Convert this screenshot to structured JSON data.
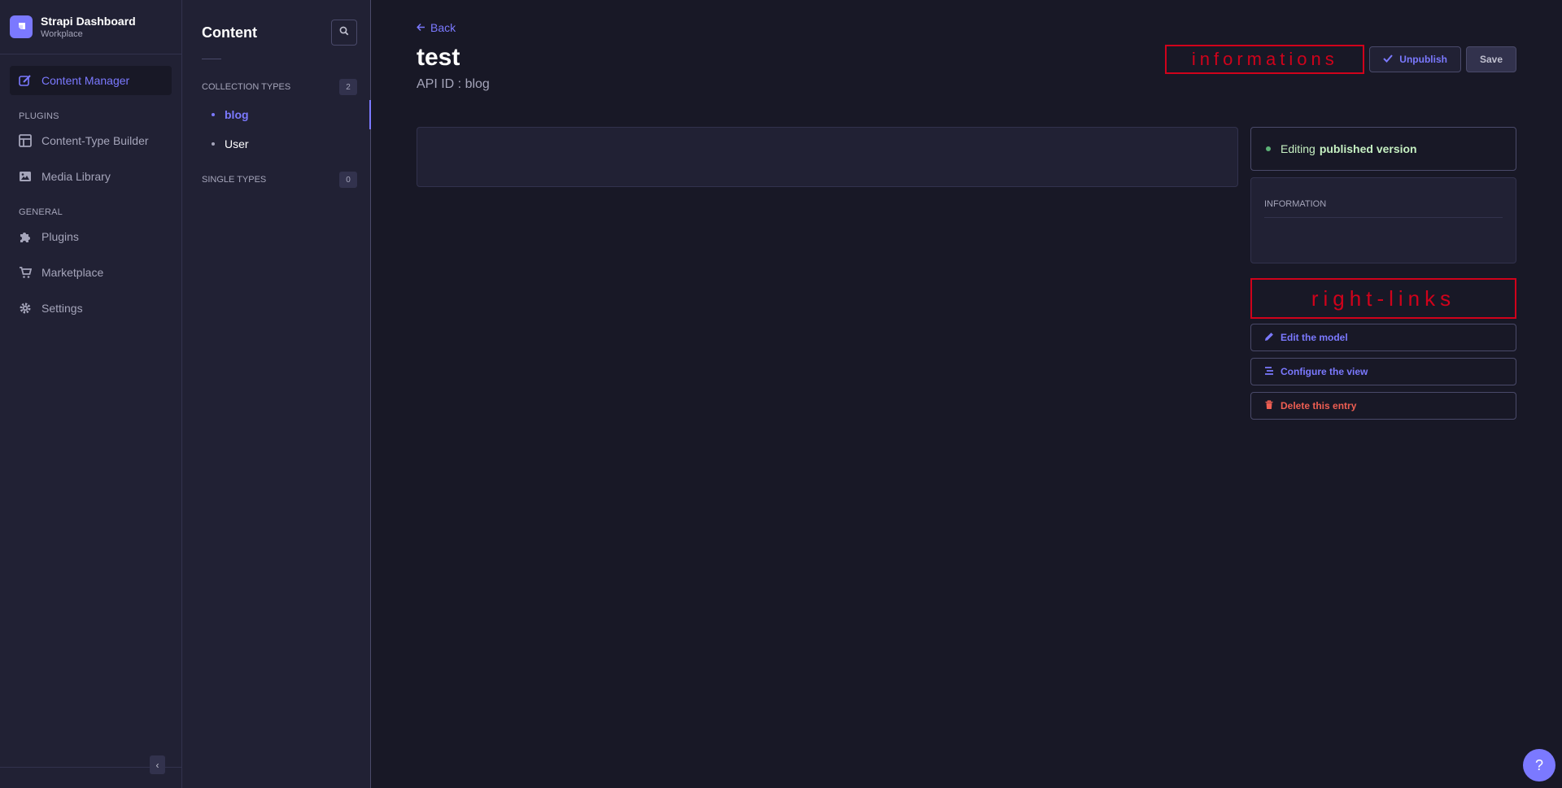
{
  "brand": {
    "name": "Strapi Dashboard",
    "workspace": "Workplace"
  },
  "mainnav": {
    "active_item": "Content Manager",
    "plugins_label": "PLUGINS",
    "plugins": [
      "Content-Type Builder",
      "Media Library"
    ],
    "general_label": "GENERAL",
    "general": [
      "Plugins",
      "Marketplace",
      "Settings"
    ]
  },
  "subnav": {
    "title": "Content",
    "collection_label": "COLLECTION TYPES",
    "collection_count": "2",
    "collection_items": [
      "blog",
      "User"
    ],
    "single_label": "SINGLE TYPES",
    "single_count": "0"
  },
  "header": {
    "back": "Back",
    "title": "test",
    "subtitle": "API ID : blog",
    "annotation": "informations",
    "unpublish": "Unpublish",
    "save": "Save"
  },
  "sidebar": {
    "status_prefix": "Editing",
    "status_strong": "published version",
    "info_title": "INFORMATION",
    "annotation": "right-links",
    "links": [
      "Edit the model",
      "Configure the view",
      "Delete this entry"
    ]
  },
  "help": "?",
  "colors": {
    "accent": "#7b79ff",
    "annotation_red": "#d0021b",
    "danger": "#ee5e52",
    "success": "#5cb176"
  }
}
